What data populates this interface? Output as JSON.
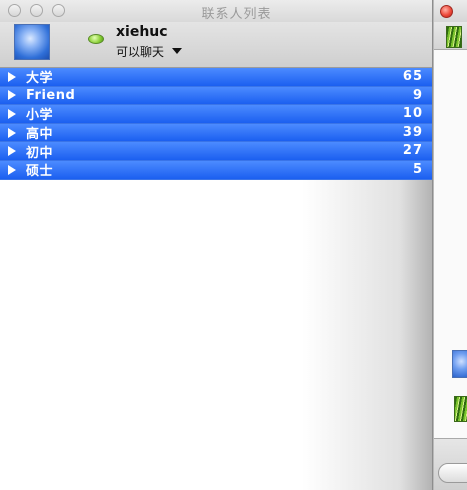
{
  "window": {
    "title": "联系人列表"
  },
  "profile": {
    "username": "xiehuc",
    "status": "可以聊天"
  },
  "groups": [
    {
      "name": "大学",
      "count": "65"
    },
    {
      "name": "Friend",
      "count": "9"
    },
    {
      "name": "小学",
      "count": "10"
    },
    {
      "name": "高中",
      "count": "39"
    },
    {
      "name": "初中",
      "count": "27"
    },
    {
      "name": "硕士",
      "count": "5"
    }
  ],
  "icons": {
    "traffic_lights": [
      "close-icon",
      "minimize-icon",
      "zoom-icon"
    ],
    "status": "online-status-icon",
    "expand": "disclosure-triangle-icon"
  },
  "colors": {
    "group_row": "#2f72f6",
    "status_online": "#8ed23b",
    "close_button_second_window": "#ee4a3c"
  }
}
